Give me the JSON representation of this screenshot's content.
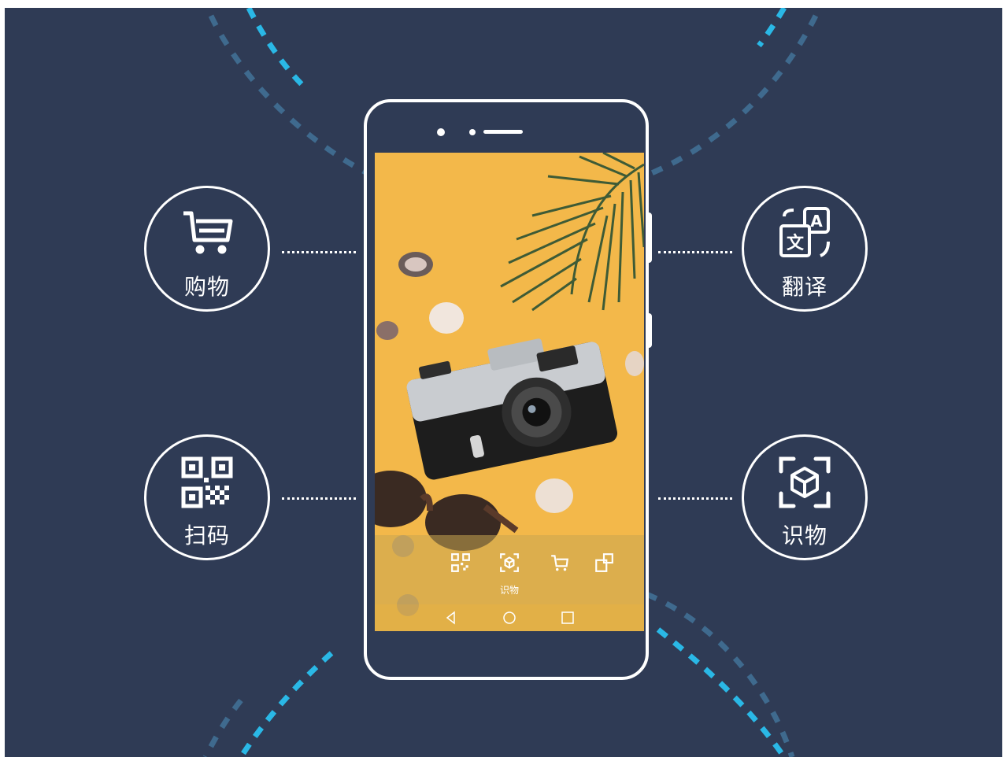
{
  "features": {
    "shopping": {
      "label": "购物",
      "icon": "shopping-cart-icon"
    },
    "scan": {
      "label": "扫码",
      "icon": "qr-code-icon"
    },
    "translate": {
      "label": "翻译",
      "icon": "translate-icon"
    },
    "identify": {
      "label": "识物",
      "icon": "object-cube-icon"
    }
  },
  "phone": {
    "active_mode_label": "识物",
    "modes": [
      "qr-code-icon",
      "object-cube-icon",
      "shopping-cart-icon",
      "translate-icon"
    ],
    "nav": [
      "back-icon",
      "home-icon",
      "recents-icon"
    ]
  },
  "colors": {
    "background": "#2f3b55",
    "accent_dash": "#2ab8e6",
    "muted_dash": "#3f6a8e",
    "screen_bg": "#f3b84a"
  }
}
